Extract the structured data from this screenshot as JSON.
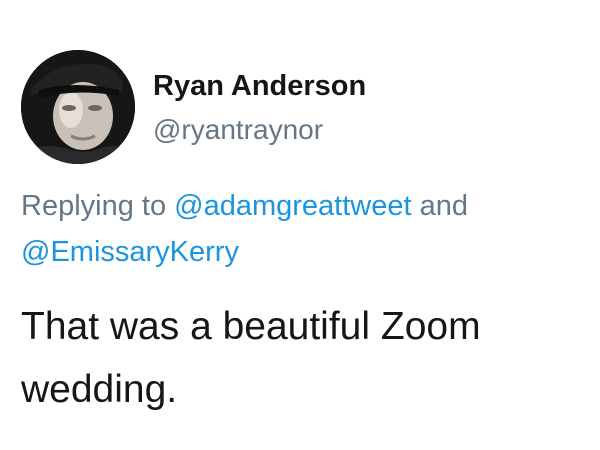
{
  "author": {
    "display_name": "Ryan Anderson",
    "handle": "@ryantraynor",
    "avatar_icon": "user-avatar-photo"
  },
  "reply": {
    "prefix": "Replying to ",
    "mention_1": "@adamgreattweet",
    "conjunction": " and",
    "mention_2": "@EmissaryKerry"
  },
  "tweet": {
    "text_line_1": "That was a beautiful Zoom",
    "text_line_2": "wedding."
  },
  "colors": {
    "text": "#14171a",
    "secondary": "#657786",
    "link": "#1b95e0"
  }
}
